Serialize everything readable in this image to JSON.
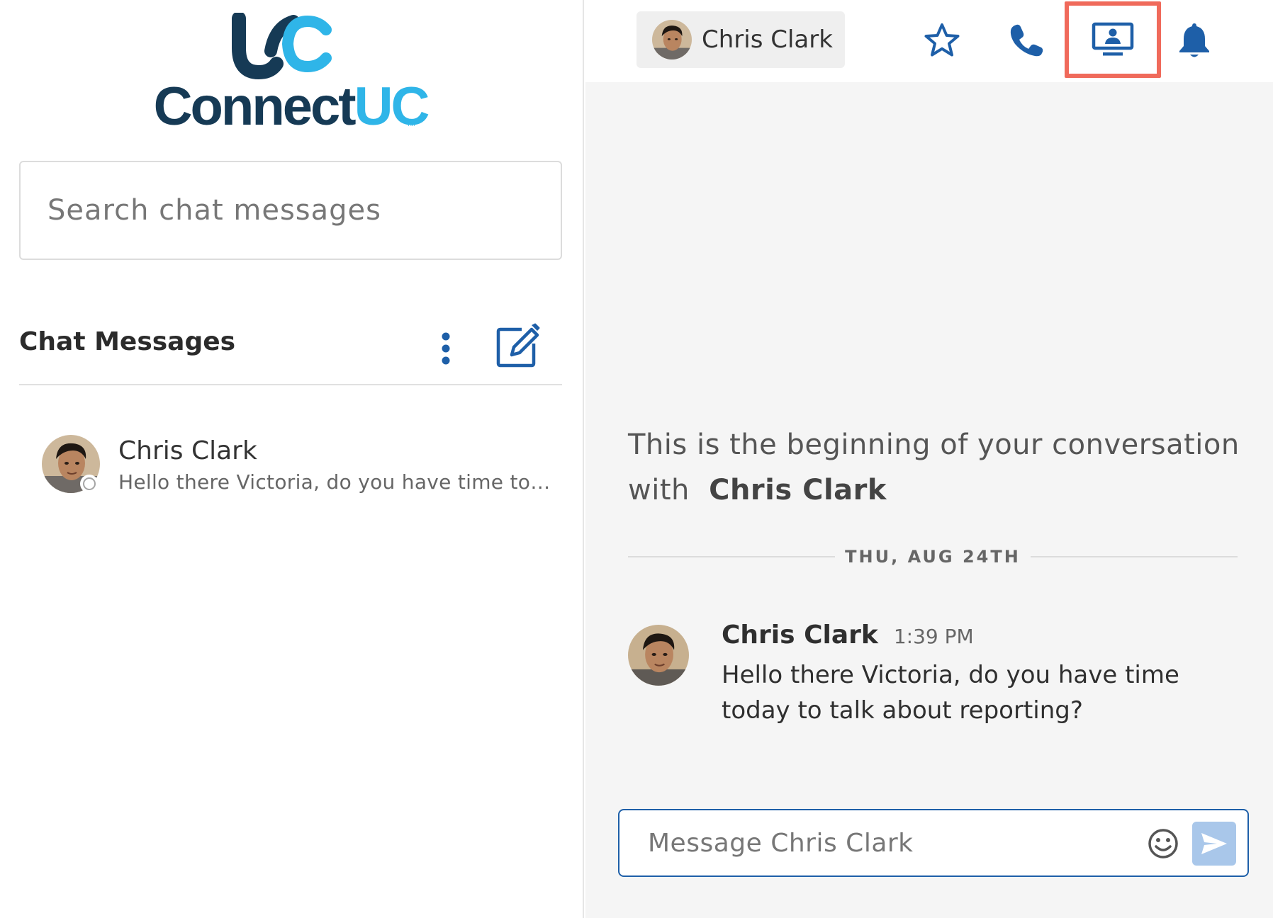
{
  "app": {
    "logo_mark": "UC",
    "logo_text_primary": "Connect",
    "logo_text_accent": "UC"
  },
  "colors": {
    "brand_dark": "#163a55",
    "brand_light": "#2fb5e8",
    "icon_blue": "#1e5fa8",
    "highlight_red": "#f06a5b",
    "send_bg": "#a9c7ea"
  },
  "sidebar": {
    "search": {
      "placeholder": "Search chat messages",
      "value": ""
    },
    "section_title": "Chat Messages",
    "more_icon": "vertical-dots-icon",
    "compose_icon": "compose-icon",
    "conversations": [
      {
        "name": "Chris Clark",
        "preview": "Hello there Victoria, do you have time toda...",
        "status": "offline"
      }
    ]
  },
  "conversation": {
    "contact_name": "Chris Clark",
    "toolbar_icons": [
      "star-icon",
      "phone-icon",
      "screen-share-icon",
      "bell-icon"
    ],
    "intro_text": "This is the beginning of your conversation with",
    "intro_name": "Chris Clark",
    "date_separator": "THU, AUG 24TH",
    "messages": [
      {
        "sender": "Chris Clark",
        "time": "1:39 PM",
        "text": "Hello there Victoria, do you have time today to talk about reporting?"
      }
    ],
    "composer": {
      "placeholder": "Message Chris Clark",
      "value": ""
    }
  }
}
